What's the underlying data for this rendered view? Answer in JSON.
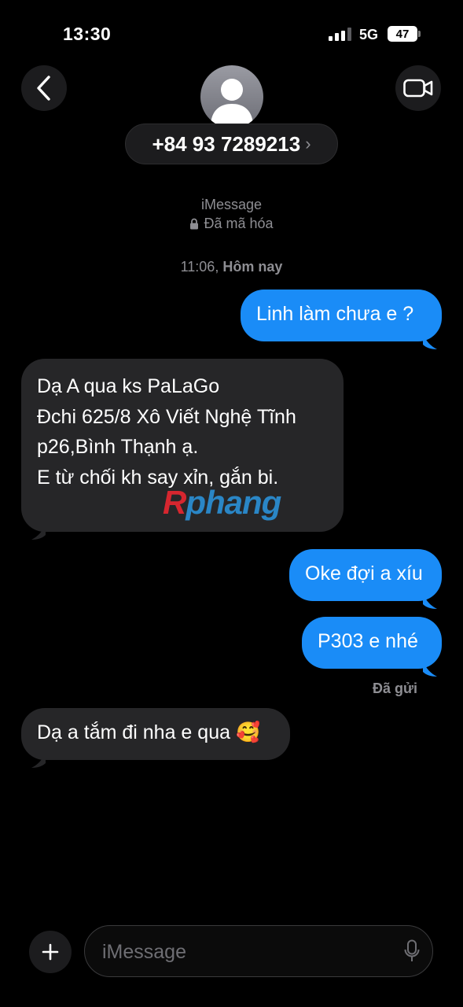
{
  "status_bar": {
    "time": "13:30",
    "network": "5G",
    "battery": "47"
  },
  "header": {
    "contact": "+84 93 7289213",
    "chevron": "›",
    "icons": {
      "back": "chevron-left-icon",
      "video": "video-camera-icon",
      "avatar": "person-icon"
    }
  },
  "conversation": {
    "service": "iMessage",
    "encrypted": "Đã mã hóa",
    "timestamp_time": "11:06,",
    "timestamp_day": "Hôm nay",
    "messages": [
      {
        "direction": "outgoing",
        "lines": [
          "Linh làm chưa e ?"
        ]
      },
      {
        "direction": "incoming",
        "lines": [
          "Dạ A qua ks PaLaGo",
          "Đchi 625/8 Xô Viết Nghệ Tĩnh",
          "p26,Bình Thạnh ạ.",
          "E từ chối kh say xỉn, gắn bi."
        ]
      },
      {
        "direction": "outgoing",
        "lines": [
          "Oke đợi a xíu"
        ]
      },
      {
        "direction": "outgoing",
        "lines": [
          "P303 e nhé"
        ]
      },
      {
        "direction": "incoming",
        "lines": [
          "Dạ a tắm đi nha e qua 🥰"
        ]
      }
    ],
    "delivery_status": "Đã gửi"
  },
  "watermark": {
    "part1": "R",
    "part2": "phang"
  },
  "composer": {
    "placeholder": "iMessage",
    "icons": {
      "plus": "plus-icon",
      "mic": "microphone-icon"
    }
  },
  "colors": {
    "outgoing": "#1a8cf7",
    "incoming": "#262628",
    "background": "#000000"
  }
}
